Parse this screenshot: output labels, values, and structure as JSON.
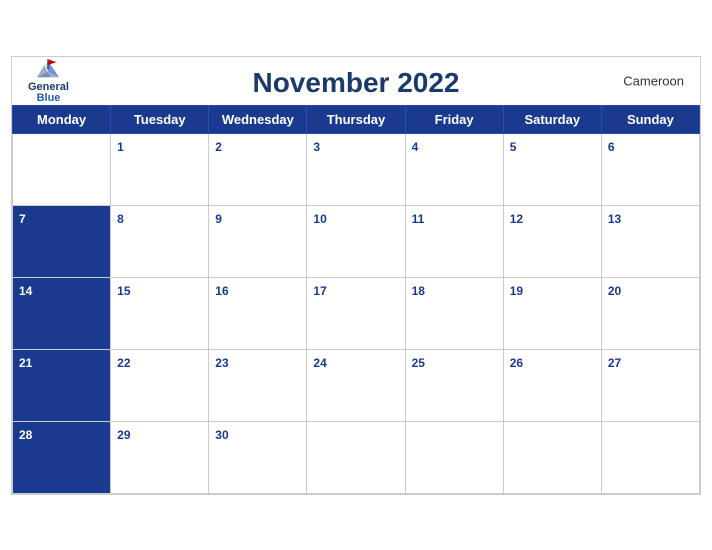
{
  "calendar": {
    "title": "November 2022",
    "country": "Cameroon",
    "days_of_week": [
      "Monday",
      "Tuesday",
      "Wednesday",
      "Thursday",
      "Friday",
      "Saturday",
      "Sunday"
    ],
    "weeks": [
      {
        "row_day": null,
        "dates": [
          null,
          1,
          2,
          3,
          4,
          5,
          6
        ]
      },
      {
        "row_day": 7,
        "dates": [
          7,
          8,
          9,
          10,
          11,
          12,
          13
        ]
      },
      {
        "row_day": 14,
        "dates": [
          14,
          15,
          16,
          17,
          18,
          19,
          20
        ]
      },
      {
        "row_day": 21,
        "dates": [
          21,
          22,
          23,
          24,
          25,
          26,
          27
        ]
      },
      {
        "row_day": 28,
        "dates": [
          28,
          29,
          30,
          null,
          null,
          null,
          null
        ]
      }
    ]
  },
  "logo": {
    "general": "General",
    "blue": "Blue"
  }
}
